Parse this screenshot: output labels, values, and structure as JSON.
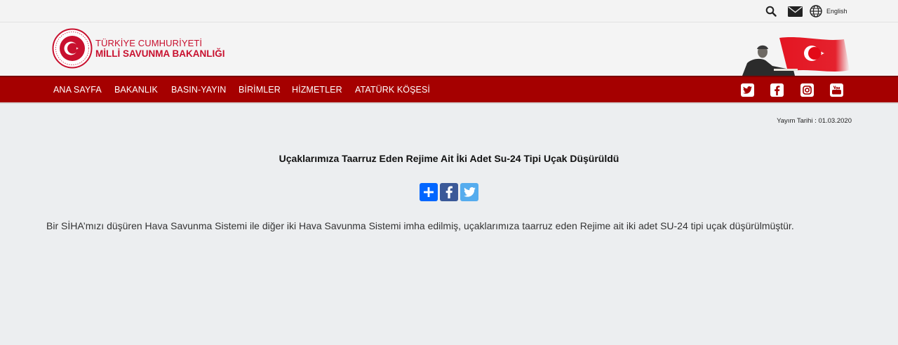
{
  "topbar": {
    "icons": [
      "search-icon",
      "mail-icon",
      "globe-icon"
    ],
    "language_label": "English"
  },
  "header": {
    "brand_line1": "TÜRKİYE CUMHURİYETİ",
    "brand_line2": "MİLLİ SAVUNMA BAKANLIĞI",
    "logo_icon": "ministry-emblem",
    "hero_image": "ataturk-flag-banner"
  },
  "nav": {
    "items": [
      "ANA SAYFA",
      "BAKANLIK",
      "BASIN-YAYIN",
      "BİRİMLER",
      "HİZMETLER",
      "ATATÜRK KÖŞESİ"
    ],
    "social": [
      "twitter-icon",
      "facebook-icon",
      "instagram-icon",
      "youtube-icon"
    ]
  },
  "article": {
    "publish_date": "Yayım Tarihi : 01.03.2020",
    "title": "Uçaklarımıza Taarruz Eden Rejime Ait İki Adet Su-24 Tipi Uçak Düşürüldü",
    "share_buttons": [
      "share-plus-icon",
      "facebook-share-icon",
      "twitter-share-icon"
    ],
    "body": "Bir SİHA’mızı düşüren Hava Savunma Sistemi ile diğer iki Hava Savunma Sistemi imha edilmiş, uçaklarımıza taarruz eden Rejime ait iki adet SU-24 tipi uçak düşürülmüştür."
  },
  "colors": {
    "nav_red": "#a50000",
    "brand_red": "#c8102e",
    "share_plus": "#0166ff",
    "share_facebook": "#3b5998",
    "share_twitter": "#55acee"
  }
}
